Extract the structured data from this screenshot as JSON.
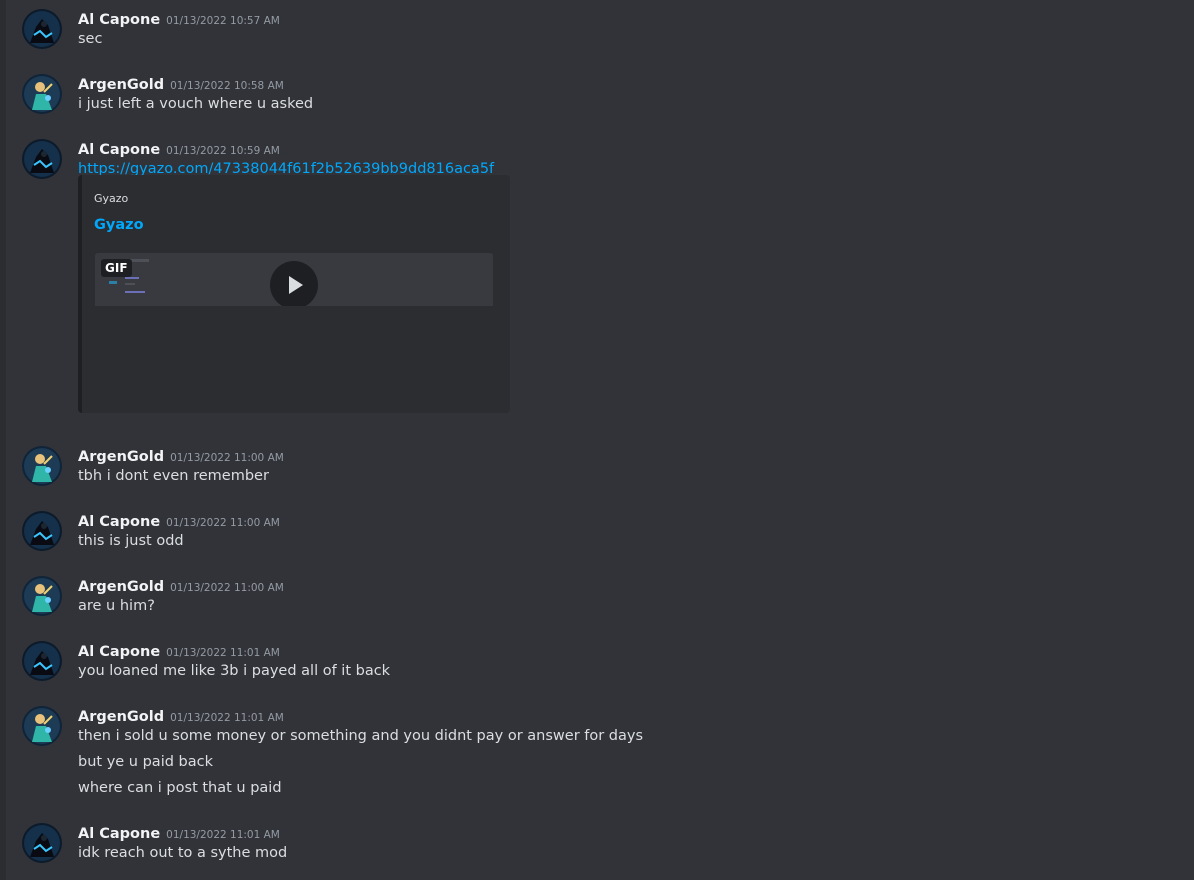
{
  "colors": {
    "background": "#313338",
    "link": "#00a8fc",
    "username": "#f2f3f5",
    "timestamp": "#949ba4"
  },
  "messages": [
    {
      "author": "Al Capone",
      "avatar_icon": "dark-figure-avatar-icon",
      "timestamp": "01/13/2022 10:57 AM",
      "lines": [
        "sec"
      ]
    },
    {
      "author": "ArgenGold",
      "avatar_icon": "anime-character-avatar-icon",
      "timestamp": "01/13/2022 10:58 AM",
      "lines": [
        "i just left a vouch where u asked"
      ]
    },
    {
      "author": "Al Capone",
      "avatar_icon": "dark-figure-avatar-icon",
      "timestamp": "01/13/2022 10:59 AM",
      "link": "https://gyazo.com/47338044f61f2b52639bb9dd816aca5f",
      "embed": {
        "provider": "Gyazo",
        "title": "Gyazo",
        "badge": "GIF",
        "play_icon": "play-icon"
      }
    },
    {
      "author": "ArgenGold",
      "avatar_icon": "anime-character-avatar-icon",
      "timestamp": "01/13/2022 11:00 AM",
      "lines": [
        "tbh i dont even remember"
      ]
    },
    {
      "author": "Al Capone",
      "avatar_icon": "dark-figure-avatar-icon",
      "timestamp": "01/13/2022 11:00 AM",
      "lines": [
        "this is just odd"
      ]
    },
    {
      "author": "ArgenGold",
      "avatar_icon": "anime-character-avatar-icon",
      "timestamp": "01/13/2022 11:00 AM",
      "lines": [
        "are u him?"
      ]
    },
    {
      "author": "Al Capone",
      "avatar_icon": "dark-figure-avatar-icon",
      "timestamp": "01/13/2022 11:01 AM",
      "lines": [
        "you loaned me like 3b i payed all of it back"
      ]
    },
    {
      "author": "ArgenGold",
      "avatar_icon": "anime-character-avatar-icon",
      "timestamp": "01/13/2022 11:01 AM",
      "lines": [
        "then i sold u some money or something and you didnt pay or answer for days",
        "but ye u paid back",
        "where can i post that u paid"
      ]
    },
    {
      "author": "Al Capone",
      "avatar_icon": "dark-figure-avatar-icon",
      "timestamp": "01/13/2022 11:01 AM",
      "lines": [
        "idk reach out to a sythe mod"
      ]
    }
  ]
}
